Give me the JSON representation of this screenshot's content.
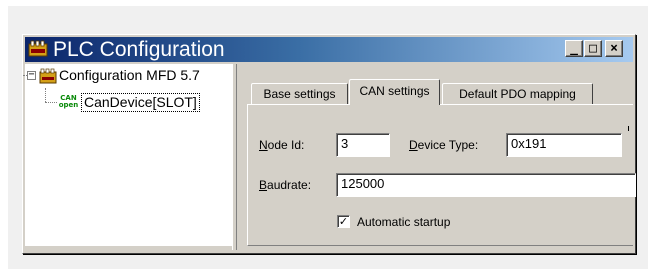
{
  "window": {
    "title": "PLC Configuration",
    "minimize_glyph": "_",
    "maximize_glyph": "□",
    "close_glyph": "×",
    "app_icon": "plc-configuration-icon"
  },
  "tree": {
    "expander_glyph": "−",
    "root": {
      "label": "Configuration MFD 5.7",
      "icon": "configuration-folder-icon"
    },
    "child": {
      "label": "CanDevice[SLOT]",
      "icon": "can-open-icon",
      "icon_text_top": "CAN",
      "icon_text_bottom": "open"
    }
  },
  "tabs": [
    {
      "label": "Base settings",
      "selected": false
    },
    {
      "label": "CAN settings",
      "selected": true
    },
    {
      "label": "Default PDO mapping",
      "selected": false
    }
  ],
  "can_settings": {
    "node_id_label_mnemonic": "N",
    "node_id_label_rest": "ode Id:",
    "node_id_value": "3",
    "device_type_label_mnemonic": "D",
    "device_type_label_rest": "evice Type:",
    "device_type_value": "0x191",
    "baudrate_label_mnemonic": "B",
    "baudrate_label_rest": "audrate:",
    "baudrate_value": "125000",
    "automatic_startup_label": "Automatic startup",
    "automatic_startup_checked": true,
    "check_glyph": "✓"
  },
  "colors": {
    "titlebar_start": "#0a246a",
    "titlebar_end": "#a6caf0",
    "face": "#d4d0c8",
    "can_icon": "#0a8a0a"
  }
}
